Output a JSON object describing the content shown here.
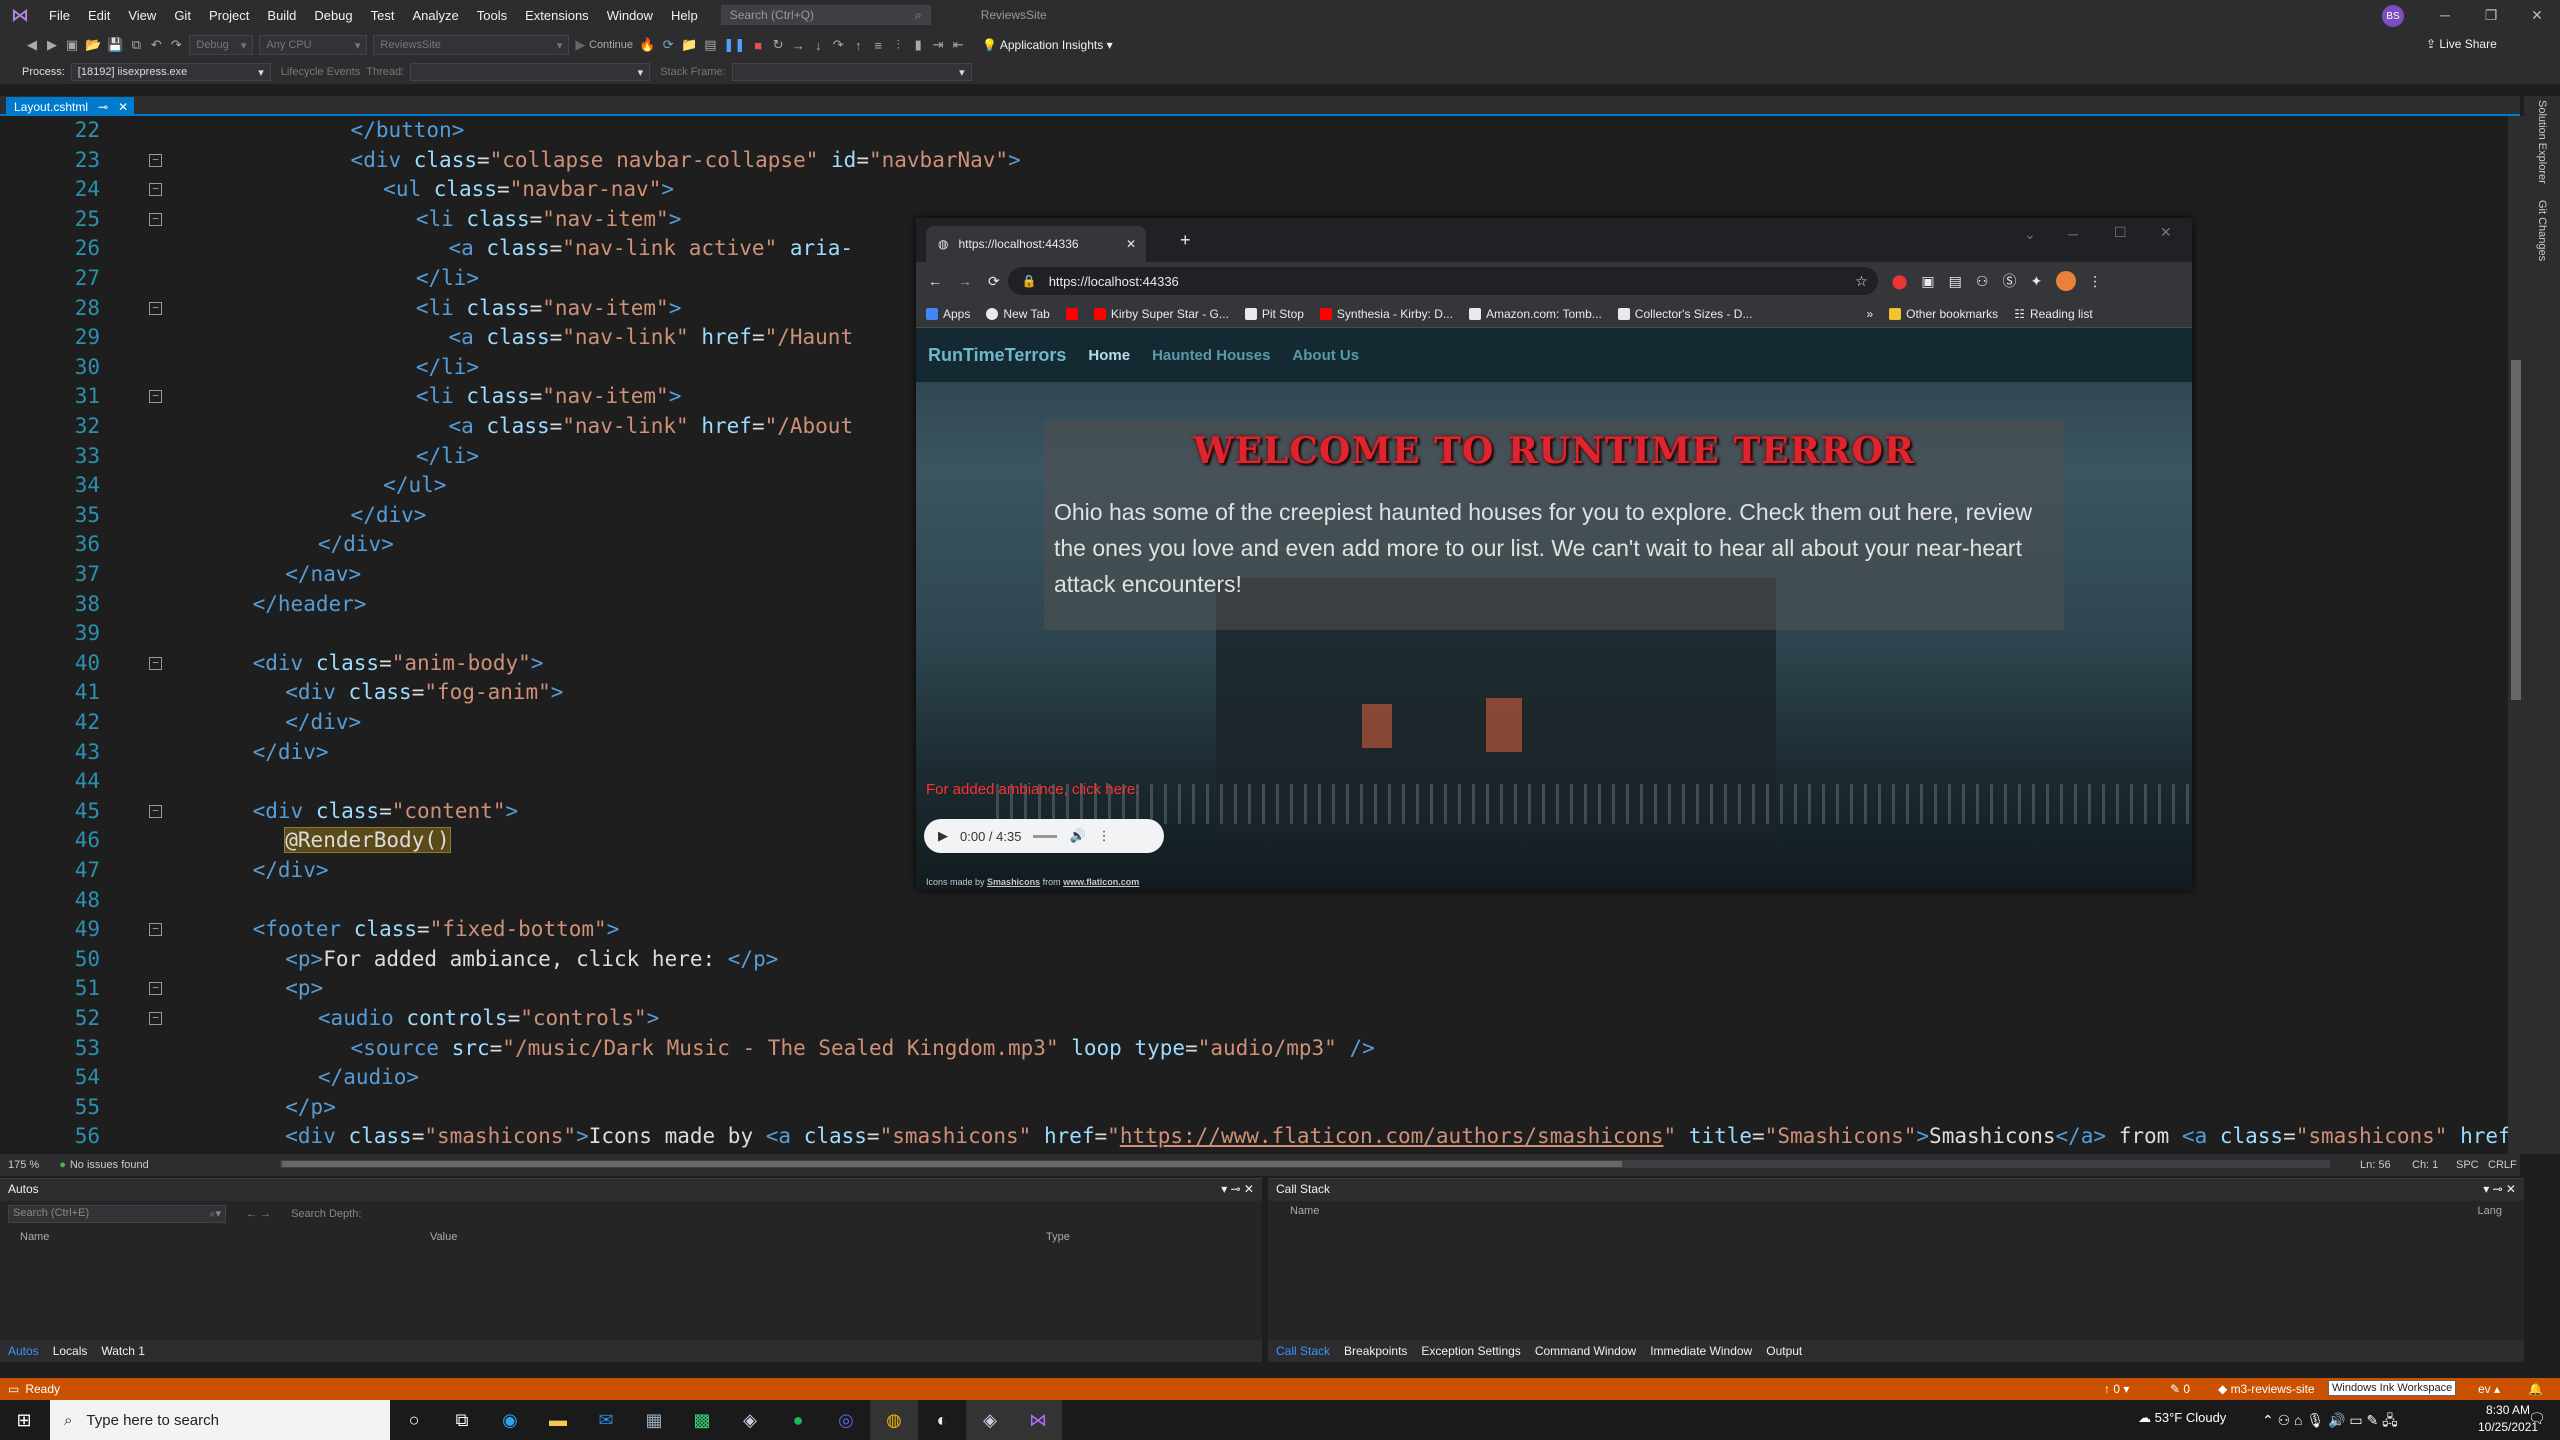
{
  "menubar": {
    "items": [
      "File",
      "Edit",
      "View",
      "Git",
      "Project",
      "Build",
      "Debug",
      "Test",
      "Analyze",
      "Tools",
      "Extensions",
      "Window",
      "Help"
    ],
    "search_placeholder": "Search (Ctrl+Q)",
    "project_name": "ReviewsSite",
    "avatar_initials": "BS"
  },
  "toolbar": {
    "config": "Debug",
    "platform": "Any CPU",
    "startup": "ReviewsSite",
    "continue_label": "Continue",
    "app_insights": "Application Insights",
    "live_share": "Live Share"
  },
  "locbar": {
    "process_label": "Process:",
    "process_value": "[18192] iisexpress.exe",
    "lifecycle": "Lifecycle Events",
    "thread_label": "Thread:",
    "stack_label": "Stack Frame:"
  },
  "doc_tab": {
    "title": "Layout.cshtml"
  },
  "editor": {
    "lines": [
      {
        "n": "22",
        "html": "<span class='tg'>&lt;/button&gt;</span>",
        "indent": 12
      },
      {
        "n": "23",
        "html": "<span class='tg'>&lt;div </span><span class='an'>class</span>=<span class='av'>\"collapse navbar-collapse\"</span> <span class='an'>id</span>=<span class='av'>\"navbarNav\"</span><span class='tg'>&gt;</span>",
        "indent": 12
      },
      {
        "n": "24",
        "html": "<span class='tg'>&lt;ul </span><span class='an'>class</span>=<span class='av'>\"navbar-nav\"</span><span class='tg'>&gt;</span>",
        "indent": 15
      },
      {
        "n": "25",
        "html": "<span class='tg'>&lt;li </span><span class='an'>class</span>=<span class='av'>\"nav-item\"</span><span class='tg'>&gt;</span>",
        "indent": 18
      },
      {
        "n": "26",
        "html": "<span class='tg'>&lt;a </span><span class='an'>class</span>=<span class='av'>\"nav-link active\"</span> <span class='an'>aria-</span>",
        "indent": 21
      },
      {
        "n": "27",
        "html": "<span class='tg'>&lt;/li&gt;</span>",
        "indent": 18
      },
      {
        "n": "28",
        "html": "<span class='tg'>&lt;li </span><span class='an'>class</span>=<span class='av'>\"nav-item\"</span><span class='tg'>&gt;</span>",
        "indent": 18
      },
      {
        "n": "29",
        "html": "<span class='tg'>&lt;a </span><span class='an'>class</span>=<span class='av'>\"nav-link\"</span> <span class='an'>href</span>=<span class='av'>\"/Haunt</span>",
        "indent": 21
      },
      {
        "n": "30",
        "html": "<span class='tg'>&lt;/li&gt;</span>",
        "indent": 18
      },
      {
        "n": "31",
        "html": "<span class='tg'>&lt;li </span><span class='an'>class</span>=<span class='av'>\"nav-item\"</span><span class='tg'>&gt;</span>",
        "indent": 18
      },
      {
        "n": "32",
        "html": "<span class='tg'>&lt;a </span><span class='an'>class</span>=<span class='av'>\"nav-link\"</span> <span class='an'>href</span>=<span class='av'>\"/About</span>",
        "indent": 21
      },
      {
        "n": "33",
        "html": "<span class='tg'>&lt;/li&gt;</span>",
        "indent": 18
      },
      {
        "n": "34",
        "html": "<span class='tg'>&lt;/ul&gt;</span>",
        "indent": 15
      },
      {
        "n": "35",
        "html": "<span class='tg'>&lt;/div&gt;</span>",
        "indent": 12
      },
      {
        "n": "36",
        "html": "<span class='tg'>&lt;/div&gt;</span>",
        "indent": 9
      },
      {
        "n": "37",
        "html": "<span class='tg'>&lt;/nav&gt;</span>",
        "indent": 6
      },
      {
        "n": "38",
        "html": "<span class='tg'>&lt;/header&gt;</span>",
        "indent": 3
      },
      {
        "n": "39",
        "html": "",
        "indent": 0
      },
      {
        "n": "40",
        "html": "<span class='tg'>&lt;div </span><span class='an'>class</span>=<span class='av'>\"anim-body\"</span><span class='tg'>&gt;</span>",
        "indent": 3
      },
      {
        "n": "41",
        "html": "<span class='tg'>&lt;div </span><span class='an'>class</span>=<span class='av'>\"fog-anim\"</span><span class='tg'>&gt;</span>",
        "indent": 6
      },
      {
        "n": "42",
        "html": "<span class='tg'>&lt;/div&gt;</span>",
        "indent": 6
      },
      {
        "n": "43",
        "html": "<span class='tg'>&lt;/div&gt;</span>",
        "indent": 3
      },
      {
        "n": "44",
        "html": "",
        "indent": 0
      },
      {
        "n": "45",
        "html": "<span class='tg'>&lt;div </span><span class='an'>class</span>=<span class='av'>\"content\"</span><span class='tg'>&gt;</span>",
        "indent": 3
      },
      {
        "n": "46",
        "html": "<span style='background:#5a4a1a;outline:1px solid #8a7a3a'>@RenderBody()</span>",
        "indent": 6
      },
      {
        "n": "47",
        "html": "<span class='tg'>&lt;/div&gt;</span>",
        "indent": 3
      },
      {
        "n": "48",
        "html": "",
        "indent": 0
      },
      {
        "n": "49",
        "html": "<span class='tg'>&lt;footer </span><span class='an'>class</span>=<span class='av'>\"fixed-bottom\"</span><span class='tg'>&gt;</span>",
        "indent": 3
      },
      {
        "n": "50",
        "html": "<span class='tg'>&lt;p&gt;</span>For added ambiance, click here: <span class='tg'>&lt;/p&gt;</span>",
        "indent": 6
      },
      {
        "n": "51",
        "html": "<span class='tg'>&lt;p&gt;</span>",
        "indent": 6
      },
      {
        "n": "52",
        "html": "<span class='tg'>&lt;audio </span><span class='an'>controls</span>=<span class='av'>\"controls\"</span><span class='tg'>&gt;</span>",
        "indent": 9
      },
      {
        "n": "53",
        "html": "<span class='tg'>&lt;source </span><span class='an'>src</span>=<span class='av'>\"/music/Dark Music - The Sealed Kingdom.mp3\"</span> <span class='an'>loop</span> <span class='an'>type</span>=<span class='av'>\"audio/mp3\"</span> <span class='tg'>/&gt;</span>",
        "indent": 12
      },
      {
        "n": "54",
        "html": "<span class='tg'>&lt;/audio&gt;</span>",
        "indent": 9
      },
      {
        "n": "55",
        "html": "<span class='tg'>&lt;/p&gt;</span>",
        "indent": 6
      },
      {
        "n": "56",
        "html": "<span class='tg'>&lt;div </span><span class='an'>class</span>=<span class='av'>\"smashicons\"</span><span class='tg'>&gt;</span>Icons made by <span class='tg'>&lt;a </span><span class='an'>class</span>=<span class='av'>\"smashicons\"</span> <span class='an'>href</span>=<span class='av'>\"<u>https://www.flaticon.com/authors/smashicons</u>\"</span> <span class='an'>title</span>=<span class='av'>\"Smashicons\"</span><span class='tg'>&gt;</span>Smashicons<span class='tg'>&lt;/a&gt;</span> from <span class='tg'>&lt;a </span><span class='an'>class</span>=<span class='av'>\"smashicons\"</span> <span class='an'>href</span>=<span class='av'>\"h</span>",
        "indent": 6
      }
    ],
    "zoom": "175 %",
    "issues": "No issues found",
    "ln": "Ln: 56",
    "ch": "Ch: 1",
    "spc": "SPC",
    "crlf": "CRLF"
  },
  "right_rail": {
    "solution_explorer": "Solution Explorer",
    "git_changes": "Git Changes"
  },
  "autos_panel": {
    "title": "Autos",
    "search_placeholder": "Search (Ctrl+E)",
    "search_depth": "Search Depth:",
    "columns": [
      "Name",
      "Value",
      "Type"
    ],
    "tabs": [
      "Autos",
      "Locals",
      "Watch 1"
    ]
  },
  "callstack_panel": {
    "title": "Call Stack",
    "columns": [
      "Name",
      "Lang"
    ],
    "tabs": [
      "Call Stack",
      "Breakpoints",
      "Exception Settings",
      "Command Window",
      "Immediate Window",
      "Output"
    ]
  },
  "statusbar": {
    "ready": "Ready",
    "up_count": "0",
    "pencil_count": "0",
    "repo": "m3-reviews-site",
    "ink_tooltip": "Windows Ink Workspace",
    "branch_suffix": "ev"
  },
  "taskbar": {
    "search_placeholder": "Type here to search",
    "weather": "53°F  Cloudy",
    "time": "8:30 AM",
    "date": "10/25/2021"
  },
  "browser": {
    "tab_title": "https://localhost:44336",
    "url": "https://localhost:44336",
    "bookmarks": [
      {
        "label": "Apps",
        "color": "#4285f4"
      },
      {
        "label": "New Tab",
        "color": "#e8eaed"
      },
      {
        "label": "",
        "color": "#ff0000"
      },
      {
        "label": "Kirby Super Star - G...",
        "color": "#ff0000"
      },
      {
        "label": "Pit Stop",
        "color": "#e8eaed"
      },
      {
        "label": "Synthesia - Kirby: D...",
        "color": "#ff0000"
      },
      {
        "label": "Amazon.com: Tomb...",
        "color": "#e8eaed"
      },
      {
        "label": "Collector's Sizes - D...",
        "color": "#e8eaed"
      }
    ],
    "other_bookmarks": "Other bookmarks",
    "reading_list": "Reading list",
    "site": {
      "brand": "RunTimeTerrors",
      "nav": [
        "Home",
        "Haunted Houses",
        "About Us"
      ],
      "welcome_title": "WELCOME TO RUNTIME TERROR",
      "welcome_text": "Ohio has some of the creepiest haunted houses for you to explore. Check them out here, review the ones you love and even add more to our list. We can't wait to hear all about your near-heart attack encounters!",
      "ambiance": "For added ambiance, click here:",
      "audio_time": "0:00 / 4:35",
      "credit_prefix": "Icons made by",
      "credit_author": "Smashicons",
      "credit_mid": "from",
      "credit_site": "www.flaticon.com"
    }
  }
}
